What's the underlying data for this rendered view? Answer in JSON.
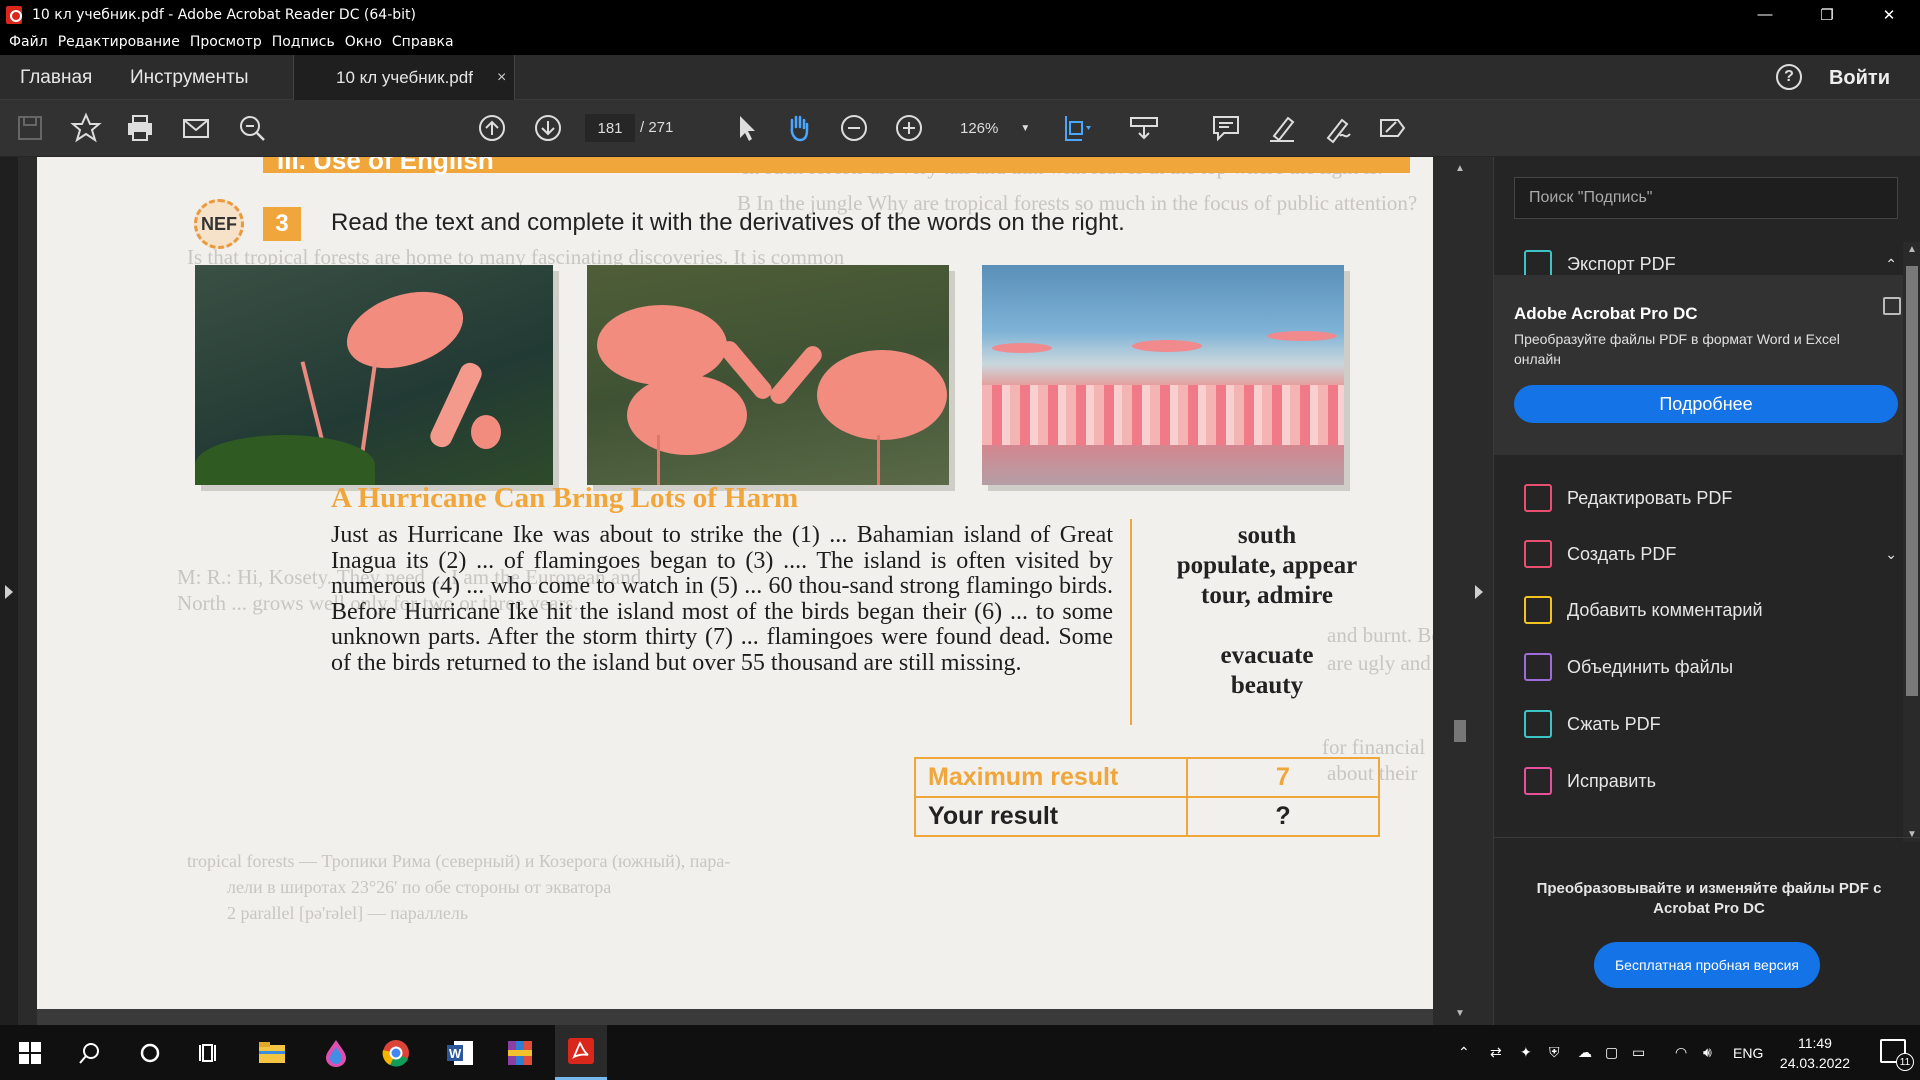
{
  "window": {
    "title": "10 кл учебник.pdf - Adobe Acrobat Reader DC (64-bit)",
    "controls": [
      "—",
      "❐",
      "✕"
    ]
  },
  "menu": [
    "Файл",
    "Редактирование",
    "Просмотр",
    "Подпись",
    "Окно",
    "Справка"
  ],
  "tabs": {
    "home": "Главная",
    "tools": "Инструменты",
    "doc": "10 кл учебник.pdf",
    "close": "×",
    "help": "?",
    "signin": "Войти"
  },
  "toolbar": {
    "page_current": "181",
    "page_total": "/ 271",
    "zoom": "126%",
    "icons": [
      "save-icon",
      "bookmark-star-icon",
      "print-icon",
      "email-icon",
      "search-zoom-icon",
      "page-up-icon",
      "page-down-icon",
      "select-pointer-icon",
      "hand-icon",
      "zoom-out-icon",
      "zoom-in-icon",
      "fit-page-icon",
      "scroll-mode-icon",
      "comment-icon",
      "highlight-pen-icon",
      "sign-icon",
      "fill-sign-icon"
    ]
  },
  "document": {
    "section_header": "III. Use of English",
    "badge": "NEF",
    "exercise_number": "3",
    "instruction": "Read the text and complete it with the derivatives of the words on the right.",
    "article_title": "A Hurricane Can Bring Lots of Harm",
    "article_body": "Just as Hurricane Ike was about to strike the (1) ... Bahamian island of Great Inagua its (2) ... of flamingoes began to (3) .... The island is often visited by numerous (4) ... who come to watch in (5) ... 60 thou-sand strong flamingo birds. Before Hurricane Ike hit the island most of the birds began their (6) ... to some unknown parts. After the storm thirty (7) ... flamingoes were found dead. Some of the birds returned to the island but over 55 thousand are still missing.",
    "words_group1": [
      "south",
      "populate, appear",
      "tour, admire"
    ],
    "words_group2": [
      "evacuate",
      "beauty"
    ],
    "result_table": [
      {
        "label": "Maximum result",
        "value": "7"
      },
      {
        "label": "Your result",
        "value": "?"
      }
    ],
    "ghost_text": [
      "In such forests are very tall and thin with leaves at the top where the light is.",
      "B  In the jungle Why are tropical forests so much in the focus of public attention?",
      "Is that tropical forests are home to many fascinating discoveries. It is common",
      "M: R.: Hi, Kosety. They need ... I am the European and",
      "North ... grows well only for two or three years.",
      "and burnt. Be-",
      "are ugly and",
      "for financial",
      "about their",
      "tropical forests — Тропики Рима (северный) и Козерога (южный), пара-",
      "лели в широтах 23°26' по обе стороны от экватора",
      "2 parallel [pə'rəlel] — параллель"
    ]
  },
  "right_panel": {
    "search_placeholder": "Поиск \"Подпись\"",
    "export_label": "Экспорт PDF",
    "promo_title": "Adobe Acrobat Pro DC",
    "promo_desc": "Преобразуйте файлы PDF в формат Word и Excel онлайн",
    "promo_button": "Подробнее",
    "tools": [
      {
        "label": "Редактировать PDF",
        "color": "#ea4f72"
      },
      {
        "label": "Создать PDF",
        "color": "#ea4f72"
      },
      {
        "label": "Добавить комментарий",
        "color": "#f2c31f"
      },
      {
        "label": "Объединить файлы",
        "color": "#9e6cd6"
      },
      {
        "label": "Сжать PDF",
        "color": "#3ac5c6"
      },
      {
        "label": "Исправить",
        "color": "#e8509b"
      }
    ],
    "footer_text": "Преобразовывайте и изменяйте файлы PDF с Acrobat Pro DC",
    "footer_button": "Бесплатная пробная версия"
  },
  "taskbar": {
    "language": "ENG",
    "time": "11:49",
    "date": "24.03.2022",
    "notifications": "11"
  }
}
